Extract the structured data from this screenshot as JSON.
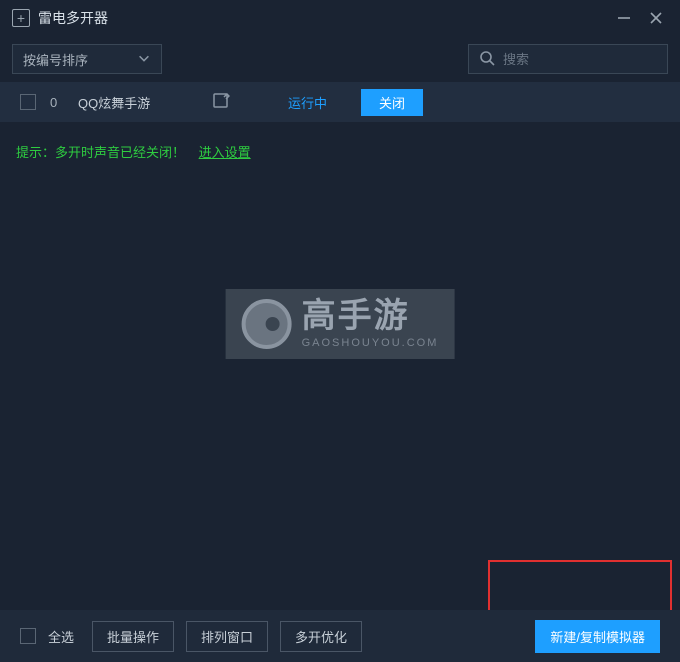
{
  "titlebar": {
    "title": "雷电多开器"
  },
  "toolbar": {
    "sort_label": "按编号排序",
    "search_placeholder": "搜索"
  },
  "row": {
    "index": "0",
    "name": "QQ炫舞手游",
    "status": "运行中",
    "close_label": "关闭"
  },
  "hint": {
    "text": "提示：多开时声音已经关闭！",
    "link": "进入设置"
  },
  "watermark": {
    "main": "高手游",
    "sub": "GAOSHOUYOU.COM"
  },
  "bottom": {
    "select_all": "全选",
    "batch": "批量操作",
    "arrange": "排列窗口",
    "optimize": "多开优化",
    "new": "新建/复制模拟器"
  }
}
